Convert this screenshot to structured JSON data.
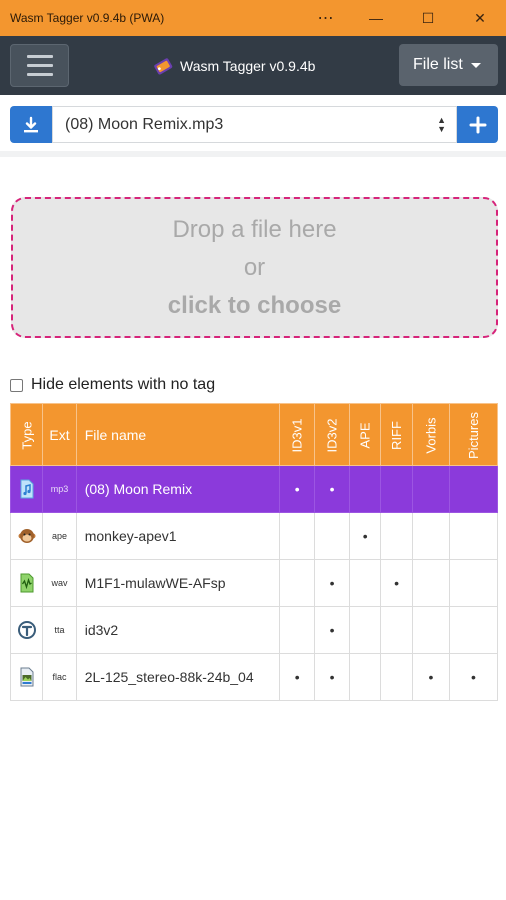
{
  "window": {
    "title": "Wasm Tagger v0.9.4b (PWA)",
    "menu_glyph": "⋯",
    "min_glyph": "—",
    "max_glyph": "☐",
    "close_glyph": "✕"
  },
  "navbar": {
    "brand": "Wasm Tagger v0.9.4b",
    "file_list_label": "File list"
  },
  "file_select": {
    "selected": "(08) Moon Remix.mp3"
  },
  "dropzone": {
    "line1": "Drop a file here",
    "line2": "or",
    "line3": "click to choose"
  },
  "hide_checkbox": {
    "label": "Hide elements with no tag",
    "checked": false
  },
  "table": {
    "headers": [
      "Type",
      "Ext",
      "File name",
      "ID3v1",
      "ID3v2",
      "APE",
      "RIFF",
      "Vorbis",
      "Pictures"
    ],
    "rows": [
      {
        "icon": "music-file-icon",
        "ext": "mp3",
        "name": "(08) Moon Remix",
        "id3v1": "•",
        "id3v2": "•",
        "ape": "",
        "riff": "",
        "vorbis": "",
        "pictures": "",
        "selected": true
      },
      {
        "icon": "monkey-file-icon",
        "ext": "ape",
        "name": "monkey-apev1",
        "id3v1": "",
        "id3v2": "",
        "ape": "•",
        "riff": "",
        "vorbis": "",
        "pictures": "",
        "selected": false
      },
      {
        "icon": "wave-file-icon",
        "ext": "wav",
        "name": "M1F1-mulawWE-AFsp",
        "id3v1": "",
        "id3v2": "•",
        "ape": "",
        "riff": "•",
        "vorbis": "",
        "pictures": "",
        "selected": false
      },
      {
        "icon": "tta-file-icon",
        "ext": "tta",
        "name": "id3v2",
        "id3v1": "",
        "id3v2": "•",
        "ape": "",
        "riff": "",
        "vorbis": "",
        "pictures": "",
        "selected": false
      },
      {
        "icon": "flac-file-icon",
        "ext": "flac",
        "name": "2L-125_stereo-88k-24b_04",
        "id3v1": "•",
        "id3v2": "•",
        "ape": "",
        "riff": "",
        "vorbis": "•",
        "pictures": "•",
        "selected": false
      }
    ]
  },
  "colors": {
    "accent": "#f3962f",
    "navbar": "#323b45",
    "primary": "#2e77d0",
    "selected_row": "#8b3adb",
    "dropzone_border": "#d6247a"
  }
}
